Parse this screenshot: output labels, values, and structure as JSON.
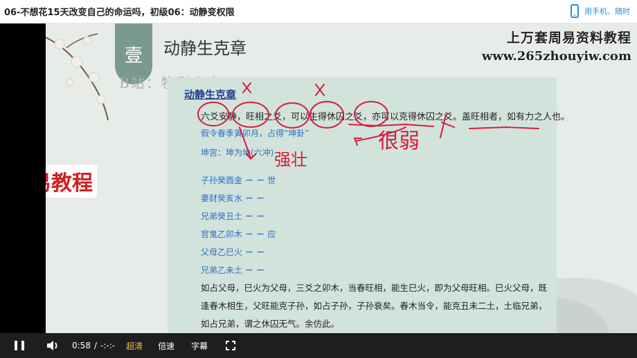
{
  "page": {
    "title": "06-不想花15天改变自己的命运吗，初级06：动静变权限",
    "mobile_label": "用手机、随时"
  },
  "slide": {
    "tag": "壹",
    "title": "动静生克章",
    "watermark_line1": "上万套周易资料教程",
    "watermark_line2": "www.265zhouyiw.com",
    "bilibili": "B站：牧引山人",
    "jiuyi": "九易教程",
    "heading": "动静生克章",
    "main_line": "六爻安静，旺相之爻，可以生得休囚之爻，亦可以克得休囚之爻。盖旺相者，如有力之人也。",
    "example": "假令春季寅卯月，占得“坤卦”",
    "palace": "坤宫：坤为地(六冲)",
    "yao_lines": [
      {
        "label": "子孙癸酉金",
        "mark": "世"
      },
      {
        "label": "妻财癸亥水",
        "mark": ""
      },
      {
        "label": "兄弟癸丑土",
        "mark": ""
      },
      {
        "label": "官鬼乙卯木",
        "mark": "应"
      },
      {
        "label": "父母乙巳火",
        "mark": ""
      },
      {
        "label": "兄弟乙未土",
        "mark": ""
      }
    ],
    "yao_symbol": "－ －",
    "paragraph": "如占父母，巳火为父母，三爻之卯木，当春旺相，能生巳火，即为父母旺相。巳火父母，既逢春木相生，父旺能克子孙，如占子孙，子孙衰矣。春木当令，能克丑未二土，土临兄弟，如占兄弟，谓之休囚无气。余仿此。",
    "handwriting": {
      "a": "强壮",
      "b": "很弱"
    }
  },
  "controls": {
    "time": "0:58",
    "separator": "/",
    "duration": "-:-:-",
    "quality": "超清",
    "speed": "倍速",
    "subtitle": "字幕",
    "accent_color": "#e6c14b"
  }
}
